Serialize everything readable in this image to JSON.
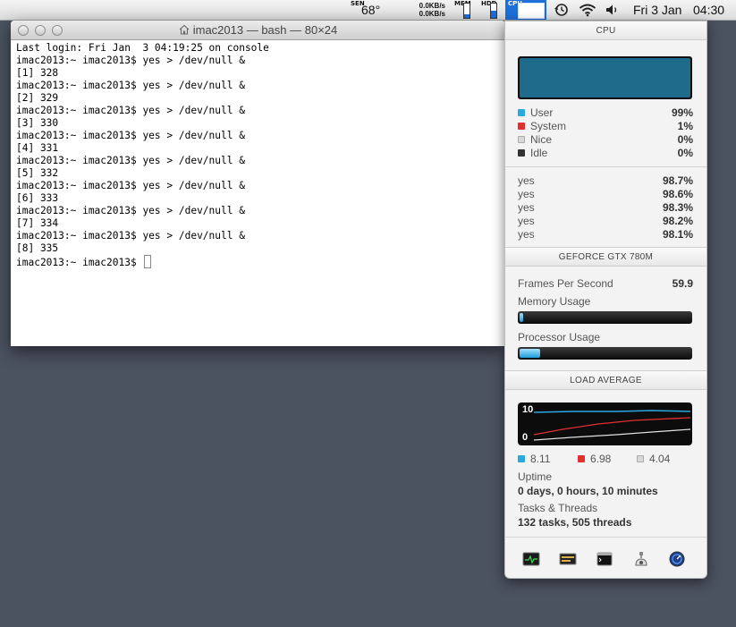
{
  "menubar": {
    "sensor_label": "SEN",
    "temperature": "68°",
    "net_up": "0.0KB/s",
    "net_down": "0.0KB/s",
    "mem_label": "MEM",
    "hdd_label": "HDD",
    "cpu_label": "CPU",
    "mem_level": 0.25,
    "hdd_level": 0.5,
    "date": "Fri 3 Jan",
    "time": "04:30",
    "icons": [
      "time-machine-icon",
      "wifi-icon",
      "volume-icon"
    ]
  },
  "terminal": {
    "title": "imac2013 — bash — 80×24",
    "lines": [
      "Last login: Fri Jan  3 04:19:25 on console",
      "imac2013:~ imac2013$ yes > /dev/null &",
      "[1] 328",
      "imac2013:~ imac2013$ yes > /dev/null &",
      "[2] 329",
      "imac2013:~ imac2013$ yes > /dev/null &",
      "[3] 330",
      "imac2013:~ imac2013$ yes > /dev/null &",
      "[4] 331",
      "imac2013:~ imac2013$ yes > /dev/null &",
      "[5] 332",
      "imac2013:~ imac2013$ yes > /dev/null &",
      "[6] 333",
      "imac2013:~ imac2013$ yes > /dev/null &",
      "[7] 334",
      "imac2013:~ imac2013$ yes > /dev/null &",
      "[8] 335"
    ],
    "prompt": "imac2013:~ imac2013$ "
  },
  "panel": {
    "cpu": {
      "heading": "CPU",
      "legend": [
        {
          "label": "User",
          "value": "99%",
          "color": "#2aa8e0"
        },
        {
          "label": "System",
          "value": "1%",
          "color": "#e03030"
        },
        {
          "label": "Nice",
          "value": "0%",
          "color": "#d8d8d8"
        },
        {
          "label": "Idle",
          "value": "0%",
          "color": "#333333"
        }
      ],
      "processes": [
        {
          "name": "yes",
          "value": "98.7%"
        },
        {
          "name": "yes",
          "value": "98.6%"
        },
        {
          "name": "yes",
          "value": "98.3%"
        },
        {
          "name": "yes",
          "value": "98.2%"
        },
        {
          "name": "yes",
          "value": "98.1%"
        }
      ],
      "graph_color": "#1f6b8c"
    },
    "gpu": {
      "heading": "GEFORCE GTX 780M",
      "fps_label": "Frames Per Second",
      "fps_value": "59.9",
      "memory_label": "Memory Usage",
      "memory_level": 0.02,
      "processor_label": "Processor Usage",
      "processor_level": 0.12
    },
    "load": {
      "heading": "LOAD AVERAGE",
      "axis_top": "10",
      "axis_bottom": "0",
      "values": [
        {
          "value": "8.11",
          "color": "#2aa8e0"
        },
        {
          "value": "6.98",
          "color": "#e03030"
        },
        {
          "value": "4.04",
          "color": "#d8d8d8"
        }
      ]
    },
    "uptime_label": "Uptime",
    "uptime_value": "0 days, 0 hours, 10 minutes",
    "tasks_label": "Tasks & Threads",
    "tasks_value": "132 tasks, 505 threads",
    "dock_icons": [
      "activity-monitor-icon",
      "console-icon",
      "terminal-icon",
      "system-profiler-icon",
      "network-utility-icon"
    ]
  }
}
